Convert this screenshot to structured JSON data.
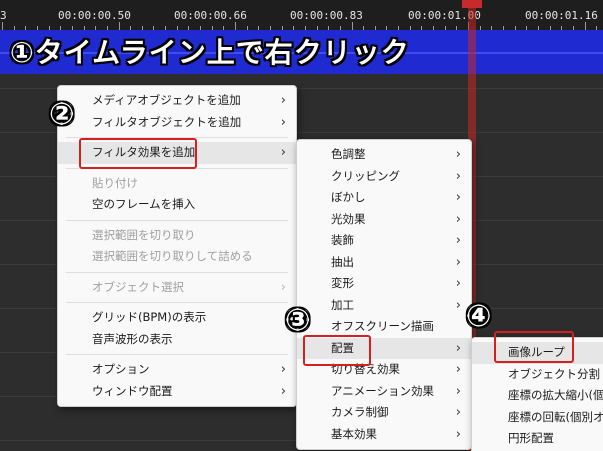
{
  "ruler": {
    "ticks": [
      "3",
      "00:00:00.50",
      "00:00:00.66",
      "00:00:00.83",
      "00:00:01.00",
      "00:00:01.16"
    ]
  },
  "annotations": {
    "title": "①タイムライン上で右クリック",
    "n2": "②",
    "n3": "③",
    "n4": "④"
  },
  "menu1": {
    "items": [
      {
        "label": "メディアオブジェクトを追加",
        "arrow": "›"
      },
      {
        "label": "フィルタオブジェクトを追加",
        "arrow": "›"
      },
      {
        "label": "フィルタ効果を追加",
        "arrow": "›"
      },
      {
        "label": "貼り付け"
      },
      {
        "label": "空のフレームを挿入"
      },
      {
        "label": "選択範囲を切り取り"
      },
      {
        "label": "選択範囲を切り取りして詰める"
      },
      {
        "label": "オブジェクト選択",
        "arrow": "›"
      },
      {
        "label": "グリッド(BPM)の表示"
      },
      {
        "label": "音声波形の表示"
      },
      {
        "label": "オプション",
        "arrow": "›"
      },
      {
        "label": "ウィンドウ配置",
        "arrow": "›"
      }
    ]
  },
  "menu2": {
    "items": [
      {
        "label": "色調整",
        "arrow": "›"
      },
      {
        "label": "クリッピング",
        "arrow": "›"
      },
      {
        "label": "ぼかし",
        "arrow": "›"
      },
      {
        "label": "光効果",
        "arrow": "›"
      },
      {
        "label": "装飾",
        "arrow": "›"
      },
      {
        "label": "抽出",
        "arrow": "›"
      },
      {
        "label": "変形",
        "arrow": "›"
      },
      {
        "label": "加工",
        "arrow": "›"
      },
      {
        "label": "オフスクリーン描画"
      },
      {
        "label": "配置",
        "arrow": "›"
      },
      {
        "label": "切り替え効果",
        "arrow": "›"
      },
      {
        "label": "アニメーション効果",
        "arrow": "›"
      },
      {
        "label": "カメラ制御",
        "arrow": "›"
      },
      {
        "label": "基本効果",
        "arrow": "›"
      }
    ]
  },
  "menu3": {
    "items": [
      {
        "label": "画像ループ"
      },
      {
        "label": "オブジェクト分割"
      },
      {
        "label": "座標の拡大縮小(個"
      },
      {
        "label": "座標の回転(個別オ"
      },
      {
        "label": "円形配置"
      }
    ]
  },
  "colors": {
    "layer_bar": "#1f2ad0",
    "cursor": "#c62a2a",
    "highlight_box": "#d42020"
  }
}
